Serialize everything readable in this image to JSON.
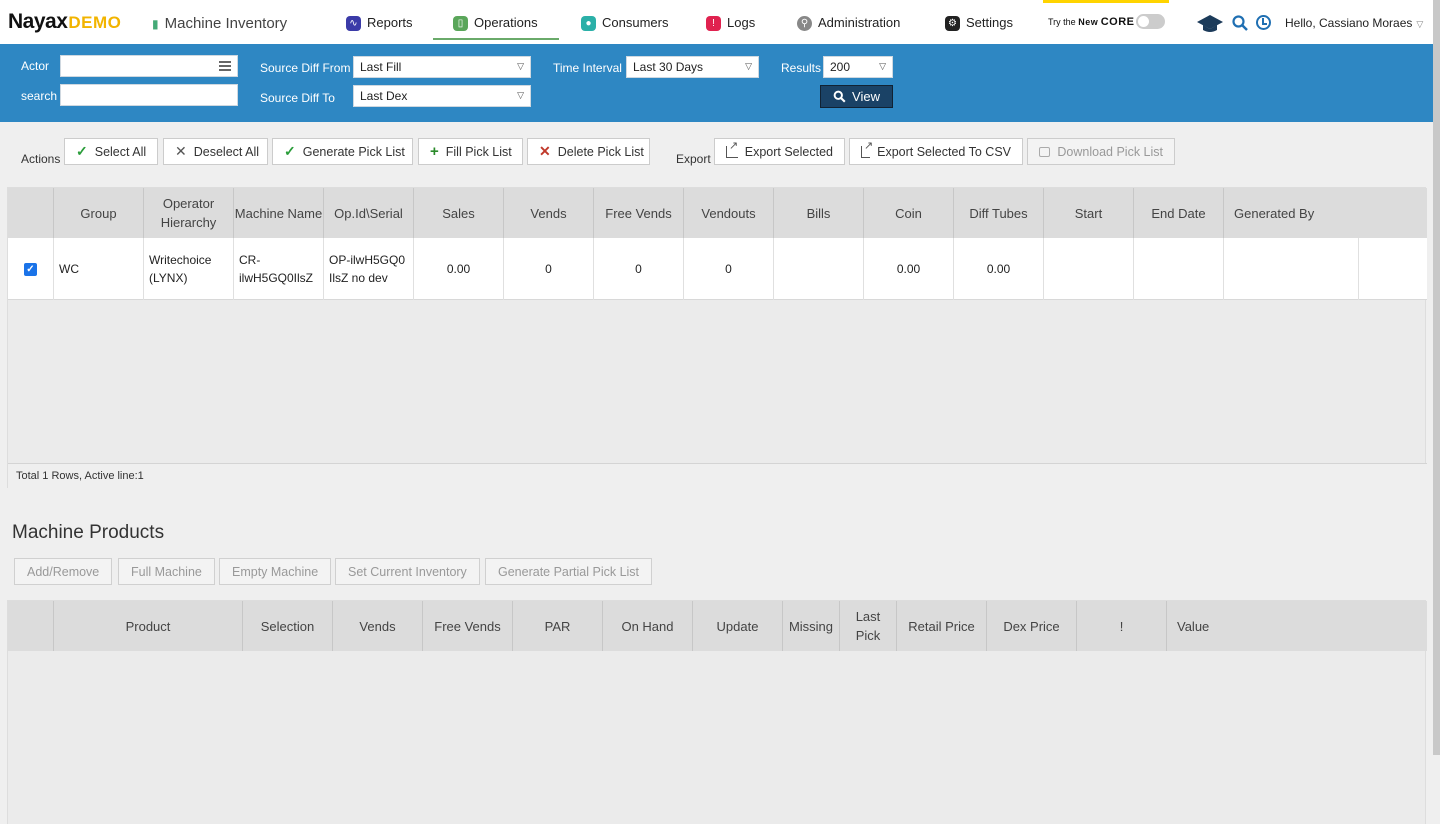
{
  "brand": {
    "logo": "Nayax",
    "demo": "DEMO"
  },
  "page_title": "Machine Inventory",
  "nav": [
    {
      "label": "Reports",
      "icon": "reports-icon",
      "color": "#3b3ba8"
    },
    {
      "label": "Operations",
      "icon": "operations-icon",
      "color": "#5aa65a"
    },
    {
      "label": "Consumers",
      "icon": "consumers-icon",
      "color": "#2bb0a8"
    },
    {
      "label": "Logs",
      "icon": "logs-icon",
      "color": "#e0224f"
    },
    {
      "label": "Administration",
      "icon": "administration-icon",
      "color": "#888888"
    },
    {
      "label": "Settings",
      "icon": "settings-icon",
      "color": "#222222"
    }
  ],
  "core": {
    "try": "Try the",
    "new": "New",
    "core": "CORE"
  },
  "user": {
    "greeting": "Hello, Cassiano Moraes"
  },
  "filters": {
    "actor_label": "Actor",
    "actor_value": "",
    "search_label": "search",
    "search_value": "",
    "source_from_label": "Source Diff From",
    "source_from_value": "Last Fill",
    "source_to_label": "Source Diff To",
    "source_to_value": "Last Dex",
    "time_label": "Time Interval",
    "time_value": "Last 30 Days",
    "results_label": "Results",
    "results_value": "200",
    "view_label": "View"
  },
  "actions": {
    "label": "Actions",
    "select_all": "Select All",
    "deselect_all": "Deselect All",
    "generate_pick": "Generate Pick List",
    "fill_pick": "Fill Pick List",
    "delete_pick": "Delete Pick List",
    "export_label": "Export",
    "export_selected": "Export Selected",
    "export_csv": "Export Selected To CSV",
    "download_pick": "Download Pick List"
  },
  "grid1": {
    "headers": [
      "Group",
      "Operator Hierarchy",
      "Machine Name",
      "Op.Id\\Serial",
      "Sales",
      "Vends",
      "Free Vends",
      "Vendouts",
      "Bills",
      "Coin",
      "Diff Tubes",
      "Start",
      "End Date",
      "Generated By"
    ],
    "row": {
      "group": "WC",
      "operator": "Writechoice (LYNX)",
      "machine": "CR-ilwH5GQ0IlsZ",
      "opid": "OP-ilwH5GQ0IlsZ no dev",
      "sales": "0.00",
      "vends": "0",
      "free_vends": "0",
      "vendouts": "0",
      "bills": "",
      "coin": "0.00",
      "diff_tubes": "0.00",
      "start": "",
      "end_date": "",
      "generated_by": ""
    },
    "footer": "Total 1 Rows, Active line:1"
  },
  "machine_products": {
    "title": "Machine Products",
    "buttons": [
      "Add/Remove",
      "Full Machine",
      "Empty Machine",
      "Set Current Inventory",
      "Generate Partial Pick List"
    ],
    "headers": [
      "Product",
      "Selection",
      "Vends",
      "Free Vends",
      "PAR",
      "On Hand",
      "Update",
      "Missing",
      "Last Pick",
      "Retail Price",
      "Dex Price",
      "!",
      "Value"
    ]
  }
}
